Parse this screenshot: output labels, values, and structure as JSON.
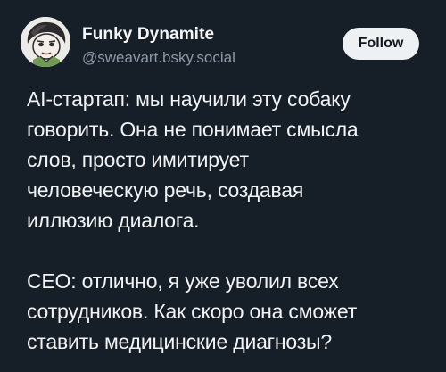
{
  "post": {
    "author": {
      "display_name": "Funky Dynamite",
      "handle": "@sweavart.bsky.social",
      "avatar": "cartoon-avatar"
    },
    "follow_label": "Follow",
    "paragraphs": [
      {
        "lines": [
          "AI-стартап: мы научили эту собаку",
          "говорить. Она не понимает смысла",
          "слов, просто имитирует",
          "человеческую речь, создавая",
          "иллюзию диалога."
        ]
      },
      {
        "lines": [
          "CEO: отлично, я уже уволил всех",
          "сотрудников. Как скоро она сможет",
          "ставить медицинские диагнозы?"
        ]
      }
    ]
  },
  "colors": {
    "background": "#161e27",
    "text": "#f1f3f5",
    "handle": "#8c99a8",
    "button_bg": "#eef1f4",
    "button_text": "#111820"
  }
}
